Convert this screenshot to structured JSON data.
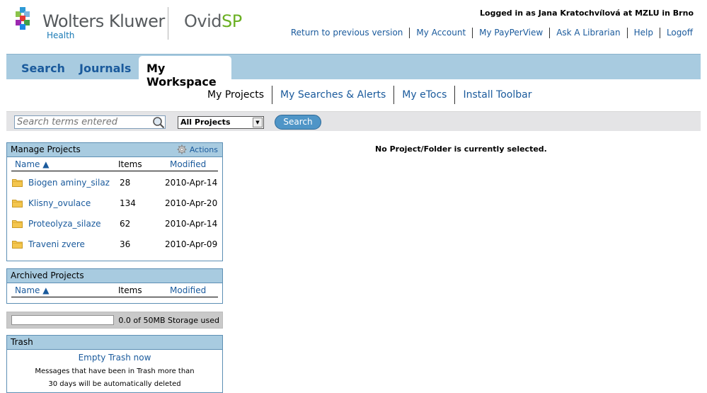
{
  "header": {
    "brand_name": "Wolters Kluwer",
    "brand_sub": "Health",
    "product_name": "Ovid",
    "product_suffix": "SP",
    "login_status": "Logged in as Jana Kratochvílová at MZLU in Brno",
    "links": [
      "Return to previous version",
      "My Account",
      "My PayPerView",
      "Ask A Librarian",
      "Help",
      "Logoff"
    ]
  },
  "tabs": {
    "search": "Search",
    "journals": "Journals",
    "workspace": "My Workspace"
  },
  "subnav": [
    "My Projects",
    "My Searches & Alerts",
    "My eTocs",
    "Install Toolbar"
  ],
  "searchbar": {
    "placeholder": "Search terms entered",
    "select_value": "All Projects",
    "button": "Search"
  },
  "manage_projects": {
    "title": "Manage Projects",
    "actions": "Actions",
    "columns": {
      "name": "Name ▲",
      "items": "Items",
      "modified": "Modified"
    },
    "rows": [
      {
        "name": "Biogen aminy_silaz",
        "items": "28",
        "modified": "2010-Apr-14"
      },
      {
        "name": "Klisny_ovulace",
        "items": "134",
        "modified": "2010-Apr-20"
      },
      {
        "name": "Proteolyza_silaze",
        "items": "62",
        "modified": "2010-Apr-14"
      },
      {
        "name": "Traveni zvere",
        "items": "36",
        "modified": "2010-Apr-09"
      }
    ]
  },
  "archived_projects": {
    "title": "Archived Projects",
    "columns": {
      "name": "Name ▲",
      "items": "Items",
      "modified": "Modified"
    }
  },
  "storage": {
    "text": "0.0 of 50MB Storage used",
    "fraction": 0.0
  },
  "trash": {
    "title": "Trash",
    "empty_link": "Empty Trash now",
    "note_line1": "Messages that have been in Trash more than",
    "note_line2": "30 days will be automatically deleted"
  },
  "main": {
    "message": "No Project/Folder is currently selected."
  },
  "colors": {
    "nav_blue": "#a8cbe0",
    "link_blue": "#1a5a9c",
    "accent_green": "#6bb023"
  }
}
